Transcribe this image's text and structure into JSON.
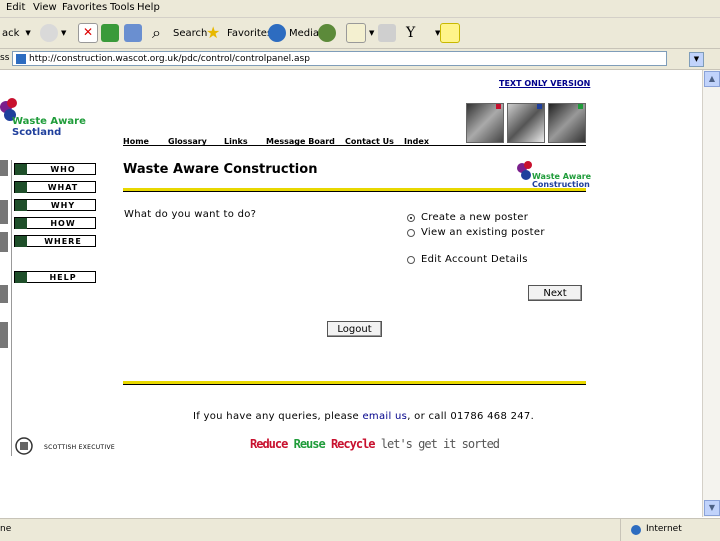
{
  "browser": {
    "menu": [
      "Edit",
      "View",
      "Favorites",
      "Tools",
      "Help"
    ],
    "toolbar": {
      "back_label": "ack",
      "search_label": "Search",
      "favorites_label": "Favorites",
      "media_label": "Media"
    },
    "address_prefix": "ss",
    "address": "http://construction.wascot.org.uk/pdc/control/controlpanel.asp",
    "status_left": "ne",
    "status_zone": "Internet"
  },
  "page": {
    "text_only_link": "TEXT ONLY VERSION",
    "logo": {
      "line1": "Waste Aware",
      "line2": "Scotland"
    },
    "nav": [
      "Home",
      "Glossary",
      "Links",
      "Message Board",
      "Contact Us",
      "Index"
    ],
    "sidebar": [
      "WHO",
      "WHAT",
      "WHY",
      "HOW",
      "WHERE",
      "HELP"
    ],
    "title": "Waste Aware Construction",
    "wac_logo": {
      "line1": "Waste Aware",
      "line2": "Construction"
    },
    "question": "What do you want to do?",
    "options": [
      {
        "label": "Create a new poster",
        "selected": true
      },
      {
        "label": "View an existing poster",
        "selected": false
      },
      {
        "label": "Edit Account Details",
        "selected": false
      }
    ],
    "next_button": "Next",
    "logout_button": "Logout",
    "footer": {
      "before": "If you have any queries, please ",
      "link": "email us",
      "after": ", or call 01786 468 247."
    },
    "scottish_exec": "SCOTTISH EXECUTIVE",
    "slogan": {
      "reduce": "Reduce",
      "reuse": "Reuse",
      "recycle": "Recycle",
      "tagline": "let's get it sorted"
    },
    "colors": {
      "reduce": "#c8102e",
      "reuse": "#1f9c3a",
      "recycle": "#c8102e",
      "rule": "#e8d800",
      "link": "#00008b"
    }
  }
}
